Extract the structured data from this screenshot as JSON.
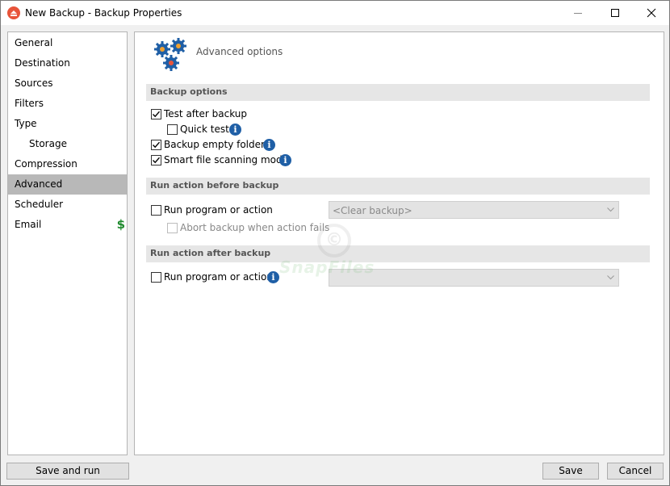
{
  "window": {
    "title": "New Backup - Backup Properties"
  },
  "sidebar": {
    "items": [
      {
        "label": "General"
      },
      {
        "label": "Destination"
      },
      {
        "label": "Sources"
      },
      {
        "label": "Filters"
      },
      {
        "label": "Type"
      },
      {
        "label": "Storage"
      },
      {
        "label": "Compression"
      },
      {
        "label": "Advanced"
      },
      {
        "label": "Scheduler"
      },
      {
        "label": "Email",
        "badge": "$"
      }
    ],
    "selected": "Advanced"
  },
  "main": {
    "header_title": "Advanced options",
    "backup_options": {
      "title": "Backup options",
      "test_after_backup": {
        "label": "Test after backup",
        "checked": true
      },
      "quick_test": {
        "label": "Quick test",
        "checked": false
      },
      "backup_empty_folders": {
        "label": "Backup empty folders",
        "checked": true
      },
      "smart_file_scanning": {
        "label": "Smart file scanning mode",
        "checked": true
      }
    },
    "run_before": {
      "title": "Run action before backup",
      "run_program": {
        "label": "Run program or action",
        "checked": false
      },
      "action_value": "<Clear backup>",
      "abort_on_fail": {
        "label": "Abort backup when action fails",
        "checked": false
      }
    },
    "run_after": {
      "title": "Run action after backup",
      "run_program": {
        "label": "Run program or action",
        "checked": false
      },
      "action_value": ""
    }
  },
  "footer": {
    "save_and_run": "Save and run",
    "save": "Save",
    "cancel": "Cancel"
  },
  "colors": {
    "selected_nav": "#b8b8b8",
    "section_bg": "#e6e6e6",
    "info_icon": "#1f5fa6",
    "dollar": "#1f8a2e",
    "app_icon": "#e8543a"
  },
  "watermark": "SnapFiles"
}
